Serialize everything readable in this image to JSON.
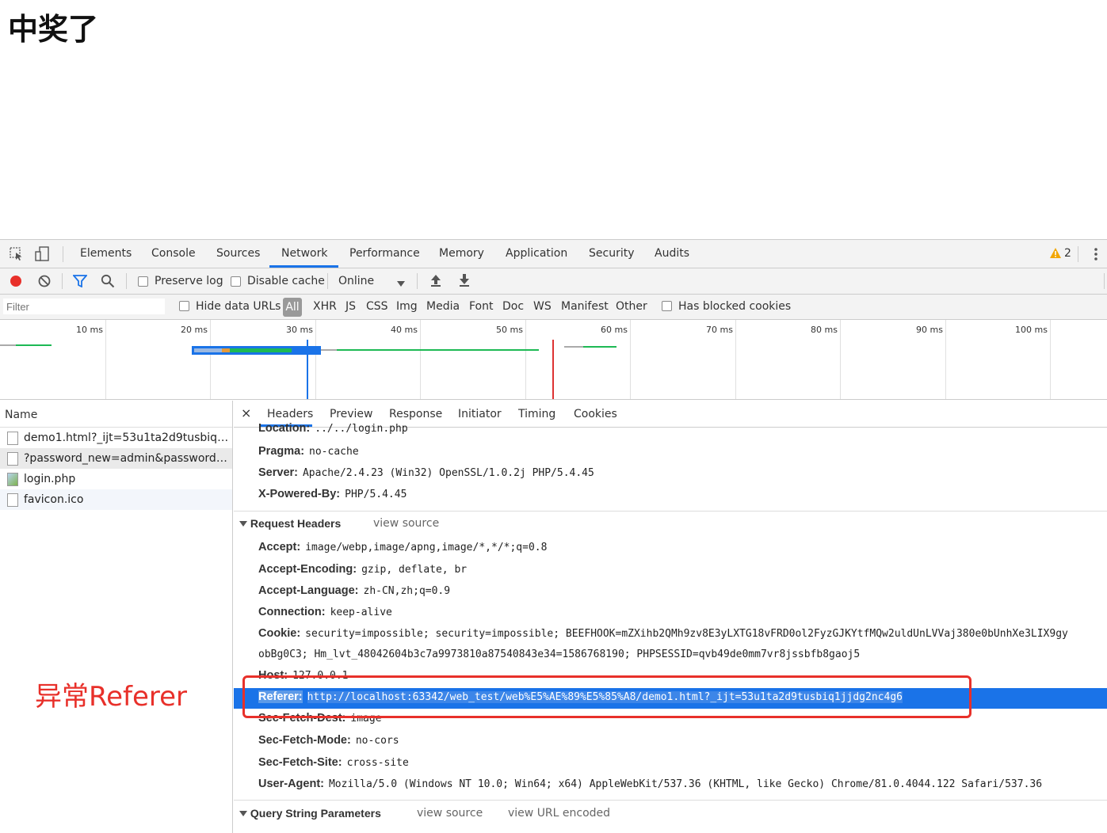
{
  "page": {
    "title": "中奖了"
  },
  "devtools": {
    "tabs": [
      "Elements",
      "Console",
      "Sources",
      "Network",
      "Performance",
      "Memory",
      "Application",
      "Security",
      "Audits"
    ],
    "active_tab": "Network",
    "warnings_count": "2",
    "controls": {
      "preserve_log": "Preserve log",
      "disable_cache": "Disable cache",
      "throttle": "Online"
    },
    "filter": {
      "placeholder": "Filter",
      "hide_data_urls": "Hide data URLs",
      "types": [
        "All",
        "XHR",
        "JS",
        "CSS",
        "Img",
        "Media",
        "Font",
        "Doc",
        "WS",
        "Manifest",
        "Other"
      ],
      "has_blocked_cookies": "Has blocked cookies"
    },
    "timeline": {
      "labels": [
        "10 ms",
        "20 ms",
        "30 ms",
        "40 ms",
        "50 ms",
        "60 ms",
        "70 ms",
        "80 ms",
        "90 ms",
        "100 ms"
      ]
    },
    "requests": {
      "header": "Name",
      "items": [
        {
          "name": "demo1.html?_ijt=53u1ta2d9tusbiq1jj..."
        },
        {
          "name": "?password_new=admin&password_c..."
        },
        {
          "name": "login.php"
        },
        {
          "name": "favicon.ico"
        }
      ]
    },
    "detail": {
      "tabs": [
        "Headers",
        "Preview",
        "Response",
        "Initiator",
        "Timing",
        "Cookies"
      ],
      "close": "×",
      "response_headers": [
        {
          "k": "Location:",
          "v": "../../login.php"
        },
        {
          "k": "Pragma:",
          "v": "no-cache"
        },
        {
          "k": "Server:",
          "v": "Apache/2.4.23 (Win32) OpenSSL/1.0.2j PHP/5.4.45"
        },
        {
          "k": "X-Powered-By:",
          "v": "PHP/5.4.45"
        }
      ],
      "request_headers_title": "Request Headers",
      "view_source": "view source",
      "request_headers": [
        {
          "k": "Accept:",
          "v": "image/webp,image/apng,image/*,*/*;q=0.8"
        },
        {
          "k": "Accept-Encoding:",
          "v": "gzip, deflate, br"
        },
        {
          "k": "Accept-Language:",
          "v": "zh-CN,zh;q=0.9"
        },
        {
          "k": "Connection:",
          "v": "keep-alive"
        },
        {
          "k": "Cookie:",
          "v": "security=impossible; security=impossible; BEEFHOOK=mZXihb2QMh9zv8E3yLXTG18vFRD0ol2FyzGJKYtfMQw2uldUnLVVaj380e0bUnhXe3LIX9gy"
        },
        {
          "k": "",
          "v": "obBg0C3; Hm_lvt_48042604b3c7a9973810a87540843e34=1586768190; PHPSESSID=qvb49de0mm7vr8jssbfb8gaoj5"
        },
        {
          "k": "Host:",
          "v": "127.0.0.1"
        },
        {
          "k": "Referer:",
          "v": "http://localhost:63342/web_test/web%E5%AE%89%E5%85%A8/demo1.html?_ijt=53u1ta2d9tusbiq1jjdg2nc4g6"
        },
        {
          "k": "Sec-Fetch-Dest:",
          "v": "image"
        },
        {
          "k": "Sec-Fetch-Mode:",
          "v": "no-cors"
        },
        {
          "k": "Sec-Fetch-Site:",
          "v": "cross-site"
        },
        {
          "k": "User-Agent:",
          "v": "Mozilla/5.0 (Windows NT 10.0; Win64; x64) AppleWebKit/537.36 (KHTML, like Gecko) Chrome/81.0.4044.122 Safari/537.36"
        }
      ],
      "query_title": "Query String Parameters",
      "view_url_encoded": "view URL encoded"
    }
  },
  "annotation": {
    "text": "异常Referer"
  },
  "colors": {
    "accent": "#1a73e8",
    "annotation": "#e8302a",
    "record": "#e8302a"
  }
}
